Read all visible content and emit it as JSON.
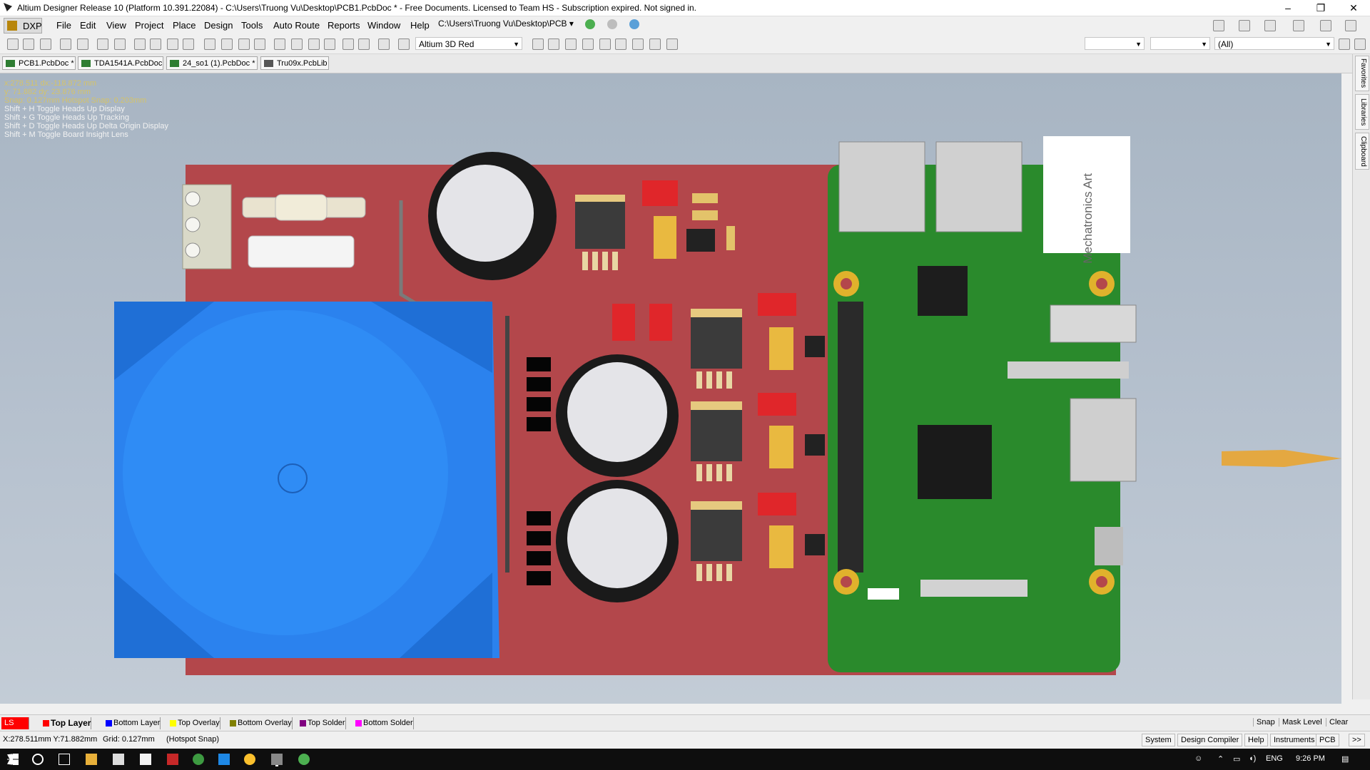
{
  "window": {
    "title": "Altium Designer Release 10 (Platform 10.391.22084) - C:\\Users\\Truong Vu\\Desktop\\PCB1.PcbDoc * - Free Documents. Licensed to Team HS - Subscription expired. Not signed in.",
    "minimize": "–",
    "maximize": "❐",
    "close": "✕"
  },
  "menu": {
    "dxp": "DXP",
    "items": [
      "File",
      "Edit",
      "View",
      "Project",
      "Place",
      "Design",
      "Tools",
      "Auto Route",
      "Reports",
      "Window",
      "Help"
    ],
    "path": "C:\\Users\\Truong Vu\\Desktop\\PCB"
  },
  "toolbar": {
    "view_config": "Altium 3D Red",
    "filter_all": "(All)"
  },
  "tabs": [
    "PCB1.PcbDoc *",
    "TDA1541A.PcbDoc",
    "24_so1 (1).PcbDoc *",
    "Tru09x.PcbLib"
  ],
  "hud": {
    "x": "x:278.511   dx:-118.872 mm",
    "y": "y: 71.882    dy: 23.876  mm",
    "snap": "Snap: 0.127mm Hotspot Snap: 0.203mm",
    "hints": [
      "Shift + H   Toggle Heads Up Display",
      "Shift + G   Toggle Heads Up Tracking",
      "Shift + D   Toggle Heads Up Delta Origin Display",
      "Shift + M  Toggle Board Insight Lens"
    ]
  },
  "board": {
    "logo_text": "Mechatronics Art"
  },
  "side_panels": [
    "Favorites",
    "Libraries",
    "Clipboard"
  ],
  "layers": {
    "ls": "LS",
    "items": [
      {
        "name": "Top Layer",
        "color": "#ff0000"
      },
      {
        "name": "Bottom Layer",
        "color": "#0000ff"
      },
      {
        "name": "Top Overlay",
        "color": "#ffff00"
      },
      {
        "name": "Bottom Overlay",
        "color": "#808000"
      },
      {
        "name": "Top Solder",
        "color": "#800080"
      },
      {
        "name": "Bottom Solder",
        "color": "#ff00ff"
      }
    ],
    "right": [
      "Snap",
      "Mask Level",
      "Clear"
    ]
  },
  "status": {
    "coords": "X:278.511mm Y:71.882mm",
    "grid": "Grid: 0.127mm",
    "snap": "(Hotspot Snap)",
    "buttons": [
      "System",
      "Design Compiler",
      "Help",
      "Instruments",
      "PCB",
      ">>"
    ]
  },
  "taskbar": {
    "lang": "ENG",
    "time": "9:26 PM"
  },
  "colors": {
    "board": "#b3474b",
    "raspberry": "#2a8a2c",
    "heatsink": "#2b82ee"
  }
}
